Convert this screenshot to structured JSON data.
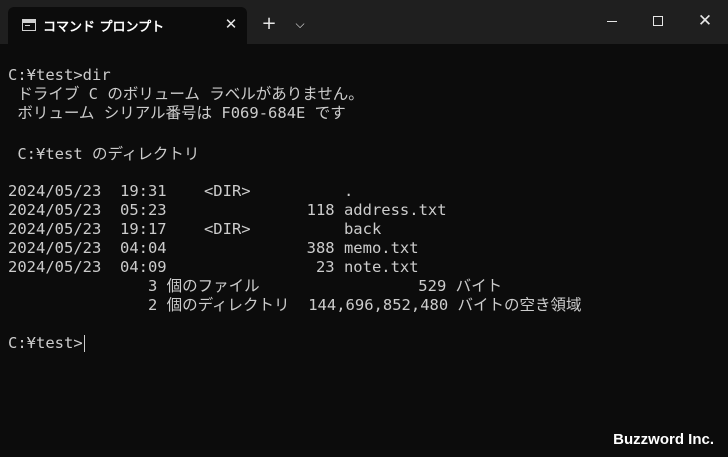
{
  "tab": {
    "icon": "terminal-icon",
    "title": "コマンド プロンプト",
    "close_glyph": "✕"
  },
  "titlebar": {
    "new_tab_glyph": "+",
    "dropdown_glyph": "⌵",
    "close_glyph": "✕"
  },
  "console": {
    "lines": [
      "C:¥test>dir",
      " ドライブ C のボリューム ラベルがありません。",
      " ボリューム シリアル番号は F069-684E です",
      "",
      " C:¥test のディレクトリ",
      "",
      "2024/05/23  19:31    <DIR>          .",
      "2024/05/23  05:23               118 address.txt",
      "2024/05/23  19:17    <DIR>          back",
      "2024/05/23  04:04               388 memo.txt",
      "2024/05/23  04:09                23 note.txt",
      "               3 個のファイル                 529 バイト",
      "               2 個のディレクトリ  144,696,852,480 バイトの空き領域",
      "",
      "C:¥test>"
    ]
  },
  "watermark": "Buzzword Inc."
}
